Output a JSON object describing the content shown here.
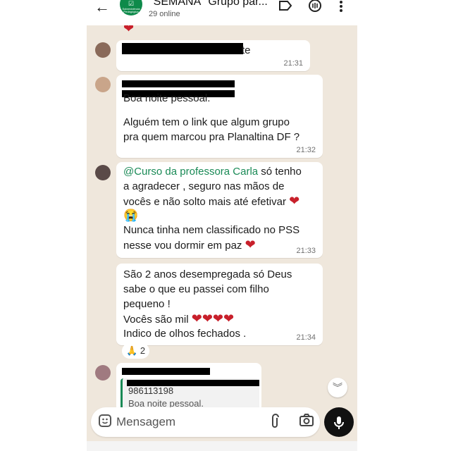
{
  "header": {
    "back_icon": "arrow-left-icon",
    "group_avatar_line1": "☑",
    "group_avatar_line2": "Sobrevivência Pedagógica",
    "title": "\"SEMANA\" Grupo par...",
    "subtitle": "29 online",
    "icons": [
      "label-icon",
      "voice-chat-icon",
      "more-vertical-icon"
    ]
  },
  "messages": [
    {
      "id": "m1",
      "visible_text": "te",
      "time": "21:31"
    },
    {
      "id": "m2",
      "lines": [
        "Boa noite pessoal.",
        "",
        "Alguém tem o link que algum grupo",
        "pra quem marcou pra Planaltina DF ?"
      ],
      "time": "21:32"
    },
    {
      "id": "m3",
      "mention": "@Curso da professora Carla",
      "line1_rest": " só tenho",
      "lines": [
        "a agradecer , seguro nas mãos de",
        "vocês e não solto mais até efetivar",
        "😭",
        "Nunca tinha nem classificado no PSS",
        "nesse vou dormir em paz"
      ],
      "time": "21:33"
    },
    {
      "id": "m4",
      "lines": [
        "São 2 anos desempregada só Deus",
        "sabe o que eu passei com filho",
        "pequeno !",
        "Vocês são mil",
        "Indico de olhos fechados ."
      ],
      "time": "21:34",
      "reaction_emoji": "🙏",
      "reaction_count": "2"
    },
    {
      "id": "m5",
      "quote_number": "986113198",
      "quote_text": "Boa noite pessoal."
    }
  ],
  "heart": "❤",
  "input": {
    "placeholder": "Mensagem"
  },
  "colors": {
    "mention": "#1a8a56",
    "heart": "#c8202b",
    "chat_bg": "#efe7dc",
    "mic_bg": "#111111"
  }
}
